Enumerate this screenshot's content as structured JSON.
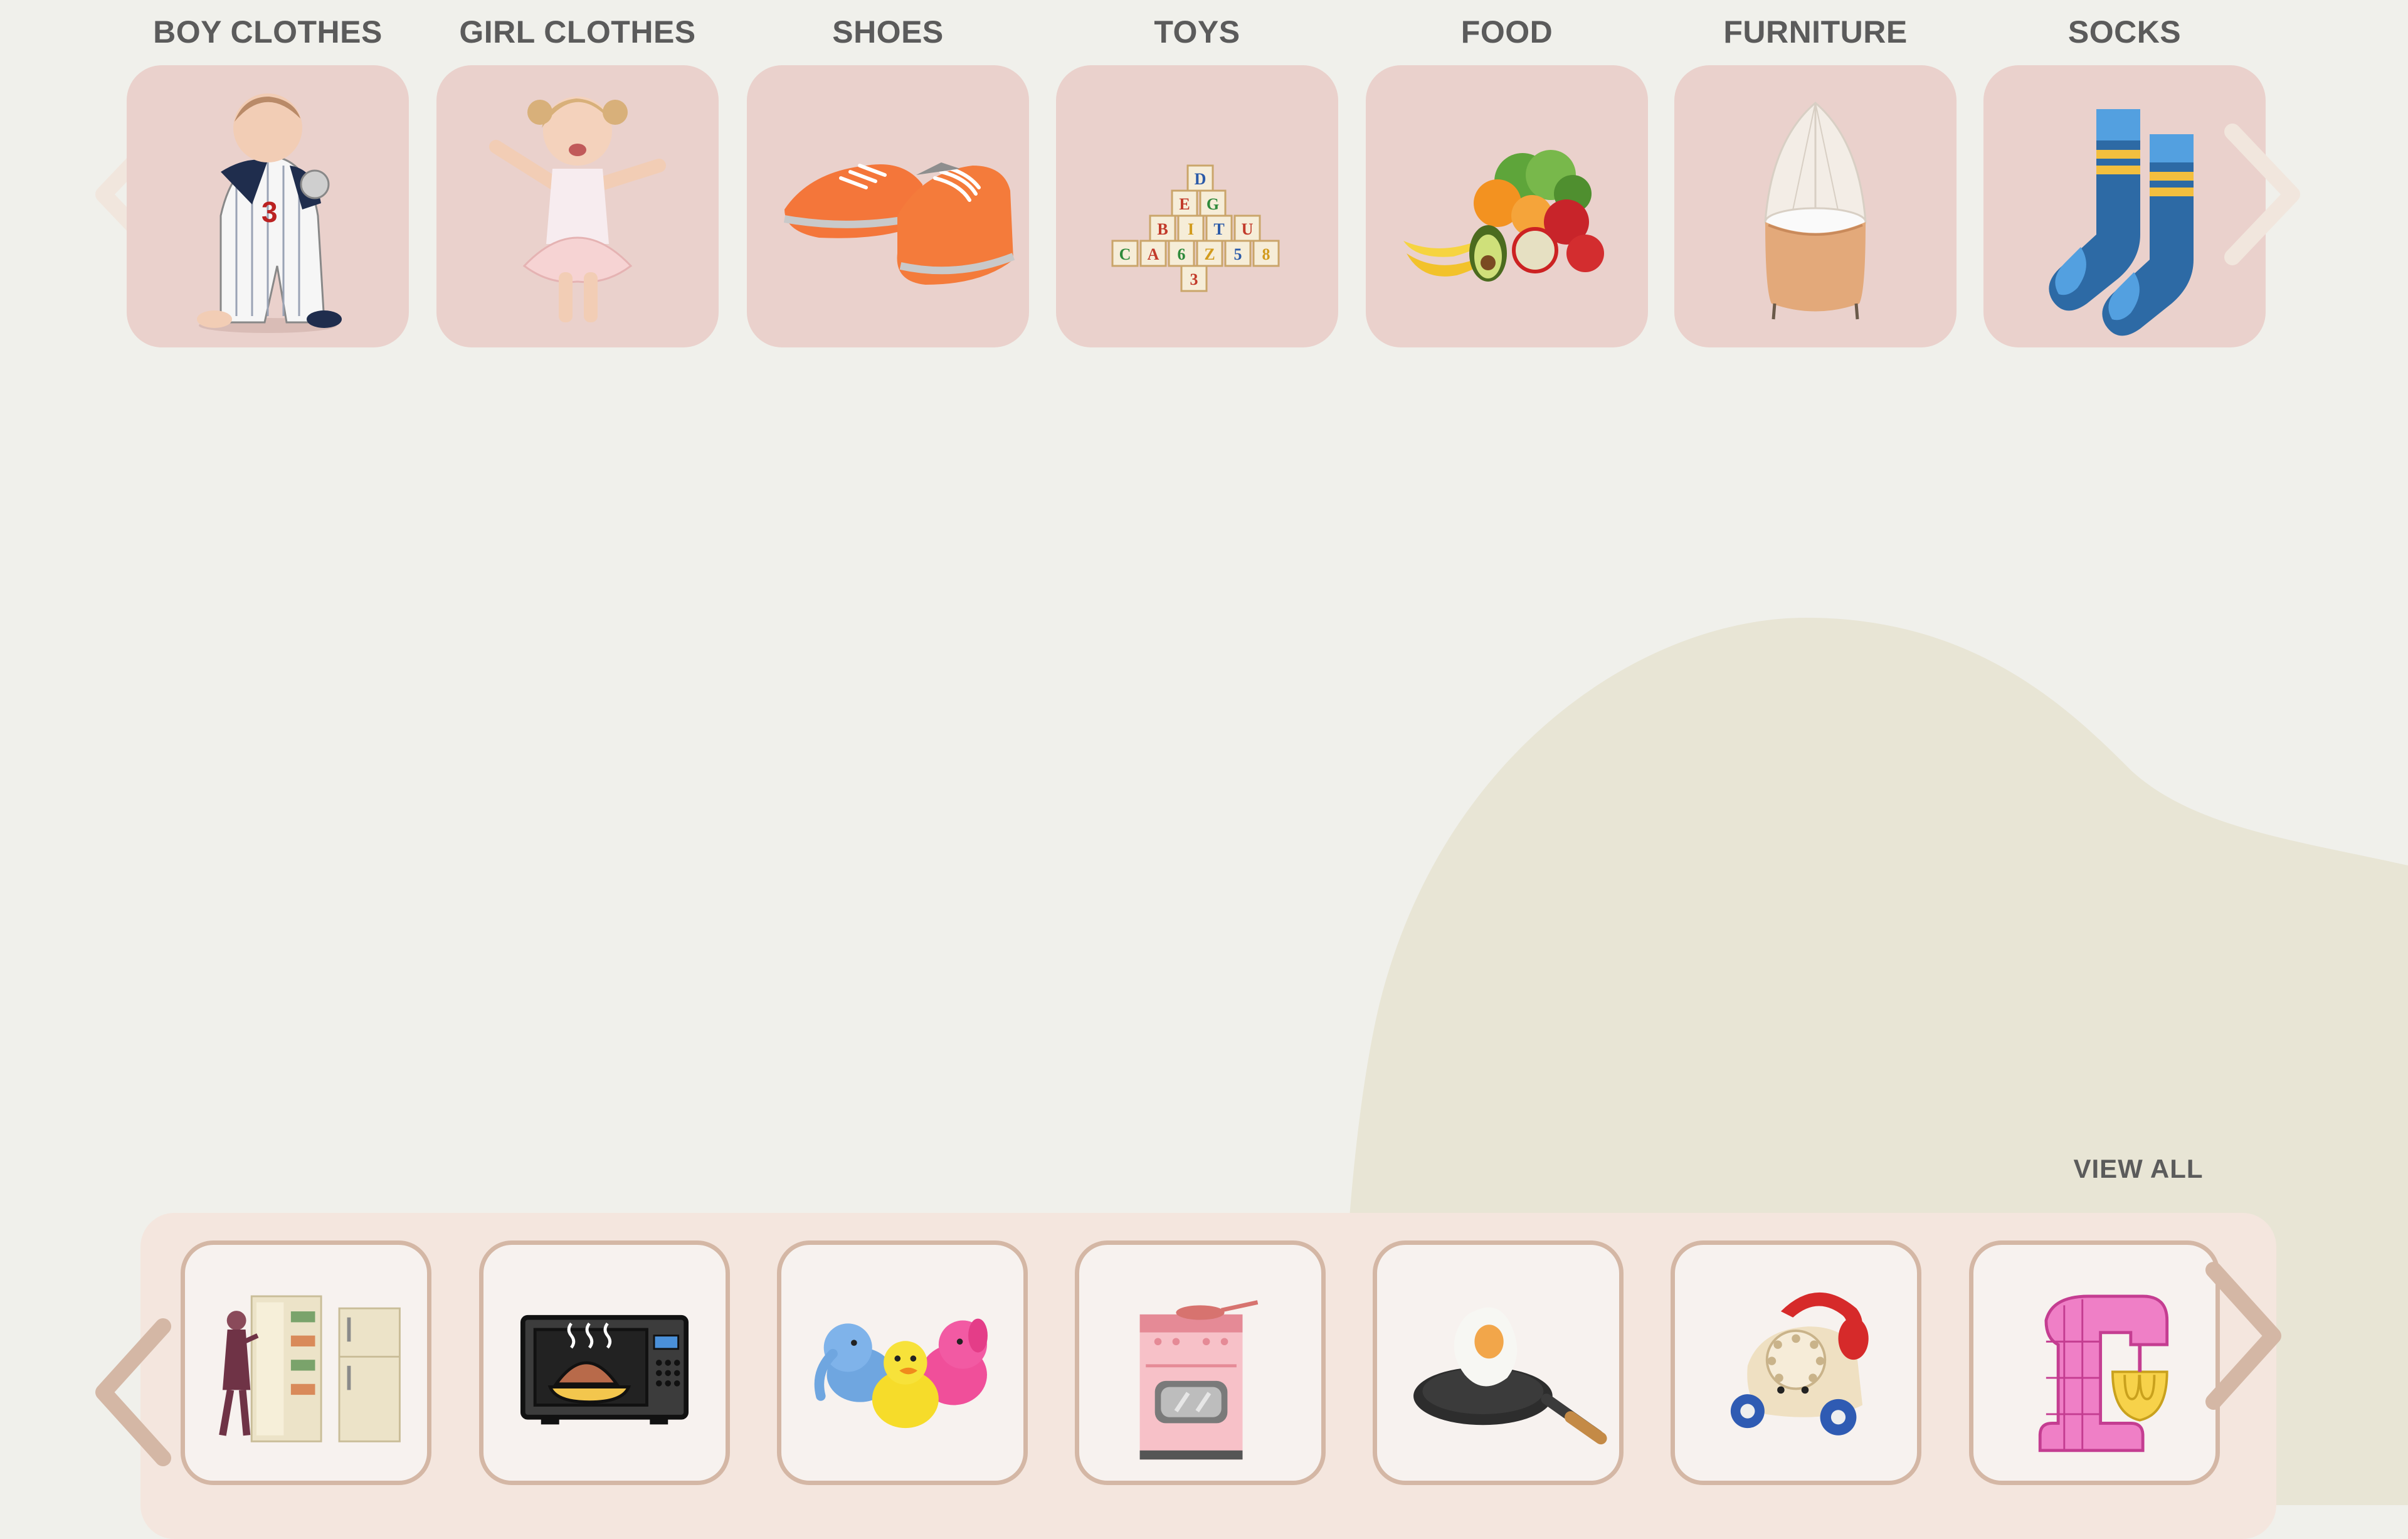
{
  "categories": [
    {
      "label": "BOY CLOTHES",
      "icon": "baby-boy-image"
    },
    {
      "label": "GIRL CLOTHES",
      "icon": "baby-girl-image"
    },
    {
      "label": "SHOES",
      "icon": "sneakers-image"
    },
    {
      "label": "TOYS",
      "icon": "alphabet-blocks-image"
    },
    {
      "label": "FOOD",
      "icon": "fruits-vegetables-image"
    },
    {
      "label": "FURNITURE",
      "icon": "bassinet-image"
    },
    {
      "label": "SOCKS",
      "icon": "socks-image"
    }
  ],
  "products": [
    {
      "icon": "fridge-image"
    },
    {
      "icon": "microwave-icon"
    },
    {
      "icon": "bath-toys-image"
    },
    {
      "icon": "toy-stove-image"
    },
    {
      "icon": "frying-pan-image"
    },
    {
      "icon": "toy-telephone-image"
    },
    {
      "icon": "stand-mixer-icon"
    }
  ],
  "view_all_label": "VIEW ALL",
  "colors": {
    "background": "#f0f0eb",
    "blob": "#e8e5d5",
    "category_card": "#ead1cc",
    "strip": "#f4e6de",
    "product_border": "#d4b7a5",
    "arrow_faded": "#f1e6dd",
    "arrow_strong": "#d4b7a5",
    "label_text": "#5b5b5b"
  }
}
